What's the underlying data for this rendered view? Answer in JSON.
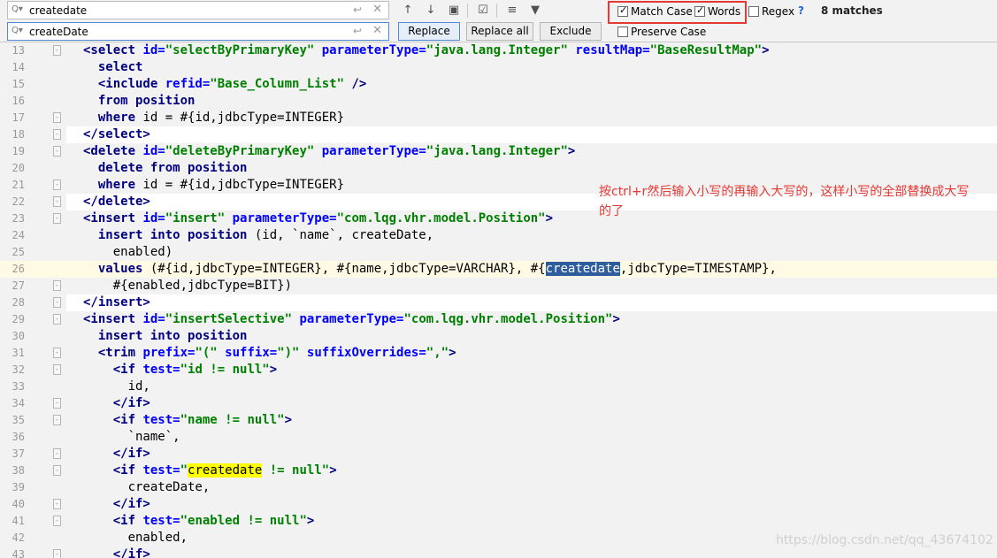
{
  "find": {
    "value": "createdate",
    "return_glyph": "↩",
    "clear_glyph": "✕"
  },
  "replace": {
    "value": "createDate",
    "return_glyph": "↩",
    "clear_glyph": "✕"
  },
  "icons": {
    "search": "search-icon",
    "up": "↑",
    "down": "↓",
    "select": "▣",
    "multi": "☑",
    "filter_lines": "≡",
    "filter": "▼"
  },
  "buttons": {
    "replace": "Replace",
    "replace_all": "Replace all",
    "exclude": "Exclude"
  },
  "options": {
    "match_case": "Match Case",
    "words": "Words",
    "regex": "Regex",
    "help": "?",
    "preserve_case": "Preserve Case"
  },
  "status": {
    "matches": "8 matches"
  },
  "annotation": {
    "text": "按ctrl+r然后输入小写的再输入大写的，这样小写的全部替换成大写的了",
    "frame_color": "#e53935"
  },
  "watermark": "https://blog.csdn.net/qq_43674102",
  "lines": [
    {
      "n": "13",
      "fold": "-",
      "tokens": [
        [
          "t",
          "<select "
        ],
        [
          "a",
          "id="
        ],
        [
          "v",
          "\"selectByPrimaryKey\" "
        ],
        [
          "a",
          "parameterType="
        ],
        [
          "v",
          "\"java.lang.Integer\" "
        ],
        [
          "a",
          "resultMap="
        ],
        [
          "v",
          "\"BaseResultMap\""
        ],
        [
          "t",
          ">"
        ]
      ]
    },
    {
      "n": "14",
      "fold": "",
      "tokens": [
        [
          "p",
          "  "
        ],
        [
          "k",
          "select"
        ]
      ]
    },
    {
      "n": "15",
      "fold": "",
      "tokens": [
        [
          "p",
          "  "
        ],
        [
          "t",
          "<include "
        ],
        [
          "a",
          "refid="
        ],
        [
          "v",
          "\"Base_Column_List\" "
        ],
        [
          "t",
          "/>"
        ]
      ]
    },
    {
      "n": "16",
      "fold": "",
      "tokens": [
        [
          "p",
          "  "
        ],
        [
          "k",
          "from "
        ],
        [
          "k",
          "position"
        ]
      ]
    },
    {
      "n": "17",
      "fold": "-",
      "tokens": [
        [
          "p",
          "  "
        ],
        [
          "k",
          "where "
        ],
        [
          "p",
          "id = #{id,jdbcType=INTEGER}"
        ]
      ]
    },
    {
      "n": "18",
      "fold": "-",
      "hl": true,
      "tokens": [
        [
          "t",
          "</select>"
        ]
      ]
    },
    {
      "n": "19",
      "fold": "-",
      "tokens": [
        [
          "t",
          "<delete "
        ],
        [
          "a",
          "id="
        ],
        [
          "v",
          "\"deleteByPrimaryKey\" "
        ],
        [
          "a",
          "parameterType="
        ],
        [
          "v",
          "\"java.lang.Integer\""
        ],
        [
          "t",
          ">"
        ]
      ]
    },
    {
      "n": "20",
      "fold": "",
      "tokens": [
        [
          "p",
          "  "
        ],
        [
          "k",
          "delete from "
        ],
        [
          "k",
          "position"
        ]
      ]
    },
    {
      "n": "21",
      "fold": "-",
      "tokens": [
        [
          "p",
          "  "
        ],
        [
          "k",
          "where "
        ],
        [
          "p",
          "id = #{id,jdbcType=INTEGER}"
        ]
      ]
    },
    {
      "n": "22",
      "fold": "-",
      "hl": true,
      "tokens": [
        [
          "t",
          "</delete>"
        ]
      ]
    },
    {
      "n": "23",
      "fold": "-",
      "tokens": [
        [
          "t",
          "<insert "
        ],
        [
          "a",
          "id="
        ],
        [
          "v",
          "\"insert\" "
        ],
        [
          "a",
          "parameterType="
        ],
        [
          "v",
          "\"com.lqg.vhr.model.Position\""
        ],
        [
          "t",
          ">"
        ]
      ]
    },
    {
      "n": "24",
      "fold": "",
      "tokens": [
        [
          "p",
          "  "
        ],
        [
          "k",
          "insert into "
        ],
        [
          "k",
          "position "
        ],
        [
          "p",
          "(id, `name`, createDate,"
        ]
      ]
    },
    {
      "n": "25",
      "fold": "",
      "tokens": [
        [
          "p",
          "    enabled)"
        ]
      ]
    },
    {
      "n": "26",
      "fold": "",
      "cur": true,
      "tokens": [
        [
          "p",
          "  "
        ],
        [
          "k",
          "values "
        ],
        [
          "p",
          "(#{id,jdbcType=INTEGER}, #{name,jdbcType=VARCHAR}, #{"
        ],
        [
          "sel",
          "createdate"
        ],
        [
          "p",
          ",jdbcType=TIMESTAMP},"
        ]
      ]
    },
    {
      "n": "27",
      "fold": "-",
      "tokens": [
        [
          "p",
          "    #{enabled,jdbcType=BIT})"
        ]
      ]
    },
    {
      "n": "28",
      "fold": "-",
      "hl": true,
      "tokens": [
        [
          "t",
          "</insert>"
        ]
      ]
    },
    {
      "n": "29",
      "fold": "-",
      "tokens": [
        [
          "t",
          "<insert "
        ],
        [
          "a",
          "id="
        ],
        [
          "v",
          "\"insertSelective\" "
        ],
        [
          "a",
          "parameterType="
        ],
        [
          "v",
          "\"com.lqg.vhr.model.Position\""
        ],
        [
          "t",
          ">"
        ]
      ]
    },
    {
      "n": "30",
      "fold": "",
      "tokens": [
        [
          "p",
          "  "
        ],
        [
          "k",
          "insert into "
        ],
        [
          "k",
          "position"
        ]
      ]
    },
    {
      "n": "31",
      "fold": "-",
      "tokens": [
        [
          "p",
          "  "
        ],
        [
          "t",
          "<trim "
        ],
        [
          "a",
          "prefix="
        ],
        [
          "v",
          "\"(\" "
        ],
        [
          "a",
          "suffix="
        ],
        [
          "v",
          "\")\" "
        ],
        [
          "a",
          "suffixOverrides="
        ],
        [
          "v",
          "\",\""
        ],
        [
          "t",
          ">"
        ]
      ]
    },
    {
      "n": "32",
      "fold": "-",
      "tokens": [
        [
          "p",
          "    "
        ],
        [
          "t",
          "<if "
        ],
        [
          "a",
          "test="
        ],
        [
          "v",
          "\"id != null\""
        ],
        [
          "t",
          ">"
        ]
      ]
    },
    {
      "n": "33",
      "fold": "",
      "tokens": [
        [
          "p",
          "      id,"
        ]
      ]
    },
    {
      "n": "34",
      "fold": "-",
      "tokens": [
        [
          "p",
          "    "
        ],
        [
          "t",
          "</if>"
        ]
      ]
    },
    {
      "n": "35",
      "fold": "-",
      "tokens": [
        [
          "p",
          "    "
        ],
        [
          "t",
          "<if "
        ],
        [
          "a",
          "test="
        ],
        [
          "v",
          "\"name != null\""
        ],
        [
          "t",
          ">"
        ]
      ]
    },
    {
      "n": "36",
      "fold": "",
      "tokens": [
        [
          "p",
          "      `name`,"
        ]
      ]
    },
    {
      "n": "37",
      "fold": "-",
      "tokens": [
        [
          "p",
          "    "
        ],
        [
          "t",
          "</if>"
        ]
      ]
    },
    {
      "n": "38",
      "fold": "-",
      "tokens": [
        [
          "p",
          "    "
        ],
        [
          "t",
          "<if "
        ],
        [
          "a",
          "test="
        ],
        [
          "v",
          "\""
        ],
        [
          "occ",
          "createdate"
        ],
        [
          "v",
          " != null\""
        ],
        [
          "t",
          ">"
        ]
      ]
    },
    {
      "n": "39",
      "fold": "",
      "tokens": [
        [
          "p",
          "      createDate,"
        ]
      ]
    },
    {
      "n": "40",
      "fold": "-",
      "tokens": [
        [
          "p",
          "    "
        ],
        [
          "t",
          "</if>"
        ]
      ]
    },
    {
      "n": "41",
      "fold": "-",
      "tokens": [
        [
          "p",
          "    "
        ],
        [
          "t",
          "<if "
        ],
        [
          "a",
          "test="
        ],
        [
          "v",
          "\"enabled != null\""
        ],
        [
          "t",
          ">"
        ]
      ]
    },
    {
      "n": "42",
      "fold": "",
      "tokens": [
        [
          "p",
          "      enabled,"
        ]
      ]
    },
    {
      "n": "43",
      "fold": "-",
      "tokens": [
        [
          "p",
          "    "
        ],
        [
          "t",
          "</if>"
        ]
      ]
    }
  ]
}
